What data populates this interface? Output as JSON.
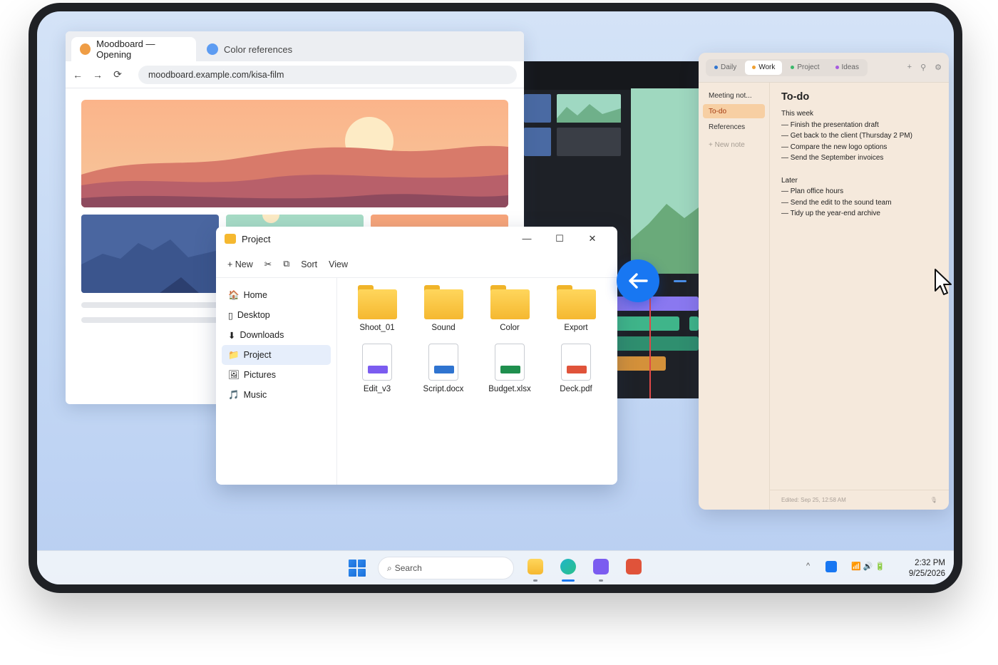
{
  "browser": {
    "tabs": [
      {
        "label": "Moodboard — Opening",
        "color": "#ef9d45",
        "active": true
      },
      {
        "label": "Color references",
        "color": "#5d9cf2",
        "active": false
      }
    ],
    "nav": {
      "back": "←",
      "forward": "→",
      "reload": "⟳"
    },
    "url": "moodboard.example.com/kisa-film"
  },
  "explorer": {
    "title": "Project",
    "window_controls": {
      "minimize": "—",
      "maximize": "☐",
      "close": "✕"
    },
    "toolbar": {
      "new": "+ New",
      "cut": "✂",
      "copy": "⧉",
      "sort": "Sort",
      "view": "View"
    },
    "sidebar": [
      {
        "icon": "🏠",
        "label": "Home"
      },
      {
        "icon": "▯",
        "label": "Desktop"
      },
      {
        "icon": "⬇",
        "label": "Downloads"
      },
      {
        "icon": "📁",
        "label": "Project",
        "selected": true
      },
      {
        "icon": "🖼",
        "label": "Pictures"
      },
      {
        "icon": "🎵",
        "label": "Music"
      }
    ],
    "folders": [
      "Shoot_01",
      "Sound",
      "Color",
      "Export"
    ],
    "files": [
      {
        "name": "Edit_v3",
        "color": "#7b5cf0"
      },
      {
        "name": "Script.docx",
        "color": "#2f74d0"
      },
      {
        "name": "Budget.xlsx",
        "color": "#1f8f4e"
      },
      {
        "name": "Deck.pdf",
        "color": "#e0533a"
      }
    ]
  },
  "notes": {
    "tabs": [
      {
        "label": "Daily",
        "color": "#2f74d0"
      },
      {
        "label": "Work",
        "color": "#f0a030",
        "active": true
      },
      {
        "label": "Project",
        "color": "#3bb86b"
      },
      {
        "label": "Ideas",
        "color": "#a65ae0"
      }
    ],
    "toolbar_icons": {
      "add": "+",
      "pin": "⚲",
      "settings": "⚙"
    },
    "list": [
      {
        "label": "Meeting not..."
      },
      {
        "label": "To-do",
        "selected": true
      },
      {
        "label": "References"
      }
    ],
    "new_note": "+ New note",
    "heading": "To-do",
    "sections": [
      {
        "title": "This week",
        "items": [
          "— Finish the presentation draft",
          "— Get back to the client (Thursday 2 PM)",
          "— Compare the new logo options",
          "— Send the September invoices"
        ]
      },
      {
        "title": "Later",
        "items": [
          "— Plan office hours",
          "— Send the edit to the sound team",
          "— Tidy up the year-end archive"
        ]
      }
    ],
    "footer": "Edited: Sep 25, 12:58 AM",
    "mic_icon": "🎙"
  },
  "taskbar": {
    "search_placeholder": "Search",
    "search_icon": "⌕",
    "tray": {
      "chevron": "^",
      "icons": "📶 🔊 🔋"
    },
    "time": "2:32 PM",
    "date": "9/25/2026"
  },
  "colors": {
    "accent": "#1877f2",
    "playhead": "#e04848"
  }
}
